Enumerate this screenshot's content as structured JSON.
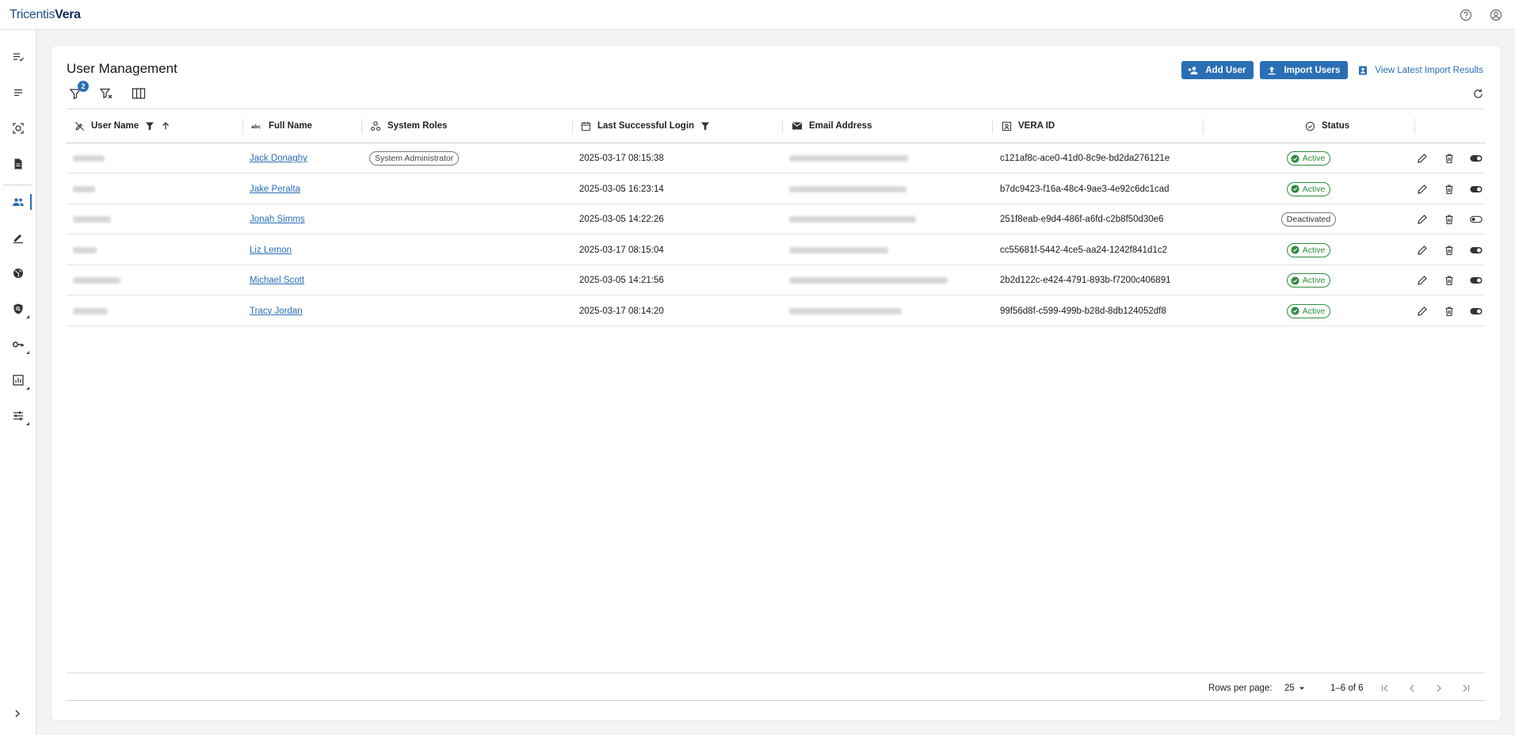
{
  "app": {
    "logo_part1": "Tricentis",
    "logo_part2": "Vera"
  },
  "topbar": {
    "help_icon": "help-circle-icon",
    "account_icon": "account-circle-icon"
  },
  "sidebar": {
    "items": [
      {
        "icon": "checklist-icon"
      },
      {
        "icon": "list-icon"
      },
      {
        "icon": "target-icon"
      },
      {
        "icon": "document-icon"
      },
      {
        "icon": "users-icon",
        "active": true
      },
      {
        "icon": "pen-icon"
      },
      {
        "icon": "globe-icon"
      },
      {
        "icon": "shield-search-icon"
      },
      {
        "icon": "key-icon"
      },
      {
        "icon": "chart-icon"
      },
      {
        "icon": "sliders-icon"
      }
    ]
  },
  "page": {
    "title": "User Management",
    "add_user": "Add User",
    "import_users": "Import Users",
    "view_import": "View Latest Import Results",
    "filter_count": "2"
  },
  "table": {
    "columns": {
      "user_name": "User Name",
      "full_name": "Full Name",
      "system_roles": "System Roles",
      "last_login": "Last Successful Login",
      "email": "Email Address",
      "vera_id": "VERA ID",
      "status": "Status"
    },
    "rows": [
      {
        "full_name": "Jack Donaghy",
        "role": "System Administrator",
        "last_login": "2025-03-17 08:15:38",
        "vera_id": "c121af8c-ace0-41d0-8c9e-bd2da276121e",
        "status": "Active"
      },
      {
        "full_name": "Jake Peralta",
        "role": "",
        "last_login": "2025-03-05 16:23:14",
        "vera_id": "b7dc9423-f16a-48c4-9ae3-4e92c6dc1cad",
        "status": "Active"
      },
      {
        "full_name": "Jonah Simms",
        "role": "",
        "last_login": "2025-03-05 14:22:26",
        "vera_id": "251f8eab-e9d4-486f-a6fd-c2b8f50d30e6",
        "status": "Deactivated"
      },
      {
        "full_name": "Liz Lemon",
        "role": "",
        "last_login": "2025-03-17 08:15:04",
        "vera_id": "cc55681f-5442-4ce5-aa24-1242f841d1c2",
        "status": "Active"
      },
      {
        "full_name": "Michael Scott",
        "role": "",
        "last_login": "2025-03-05 14:21:56",
        "vera_id": "2b2d122c-e424-4791-893b-f7200c406891",
        "status": "Active"
      },
      {
        "full_name": "Tracy Jordan",
        "role": "",
        "last_login": "2025-03-17 08:14:20",
        "vera_id": "99f56d8f-c599-499b-b28d-8db124052df8",
        "status": "Active"
      }
    ]
  },
  "footer": {
    "rows_per_page_label": "Rows per page:",
    "rows_per_page_value": "25",
    "range": "1–6 of 6"
  },
  "colors": {
    "accent": "#2a6fb5",
    "active_green": "#2e8b3d"
  }
}
